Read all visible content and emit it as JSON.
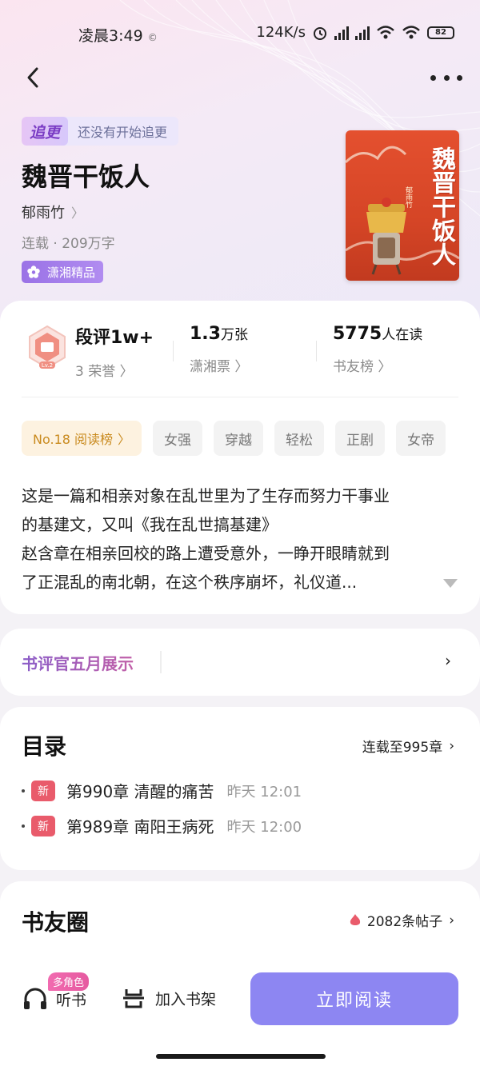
{
  "status_bar": {
    "time": "凌晨3:49",
    "net_speed": "124K/s",
    "battery": "82"
  },
  "book": {
    "follow_tag": "追更",
    "follow_text": "还没有开始追更",
    "title": "魏晋干饭人",
    "author": "郁雨竹",
    "status": "连载 · 209万字",
    "badge": "潇湘精品",
    "cover_title": "魏晋干饭人",
    "cover_author": "郁雨竹"
  },
  "stats": {
    "honor_level": "Lv.2",
    "review_value": "段评1w+",
    "review_sub": "3 荣誉",
    "ticket_value": "1.3",
    "ticket_unit": "万张",
    "ticket_sub": "潇湘票",
    "reader_value": "5775",
    "reader_unit": "人在读",
    "reader_sub": "书友榜"
  },
  "tags": {
    "rank": "No.18 阅读榜",
    "items": [
      "女强",
      "穿越",
      "轻松",
      "正剧",
      "女帝"
    ]
  },
  "description": [
    " 这是一篇和相亲对象在乱世里为了生存而努力干事业",
    "的基建文，又叫《我在乱世搞基建》",
    " 赵含章在相亲回校的路上遭受意外，一睁开眼睛就到",
    "了正混乱的南北朝，在这个秩序崩坏，礼仪道..."
  ],
  "banner": {
    "label": "书评官五月展示"
  },
  "toc": {
    "title": "目录",
    "progress": "连载至995章",
    "chapters": [
      {
        "badge": "新",
        "name": "第990章 清醒的痛苦",
        "time": "昨天 12:01"
      },
      {
        "badge": "新",
        "name": "第989章 南阳王病死",
        "time": "昨天 12:00"
      }
    ]
  },
  "community": {
    "title": "书友圈",
    "posts": "2082条帖子"
  },
  "bottom": {
    "multi_role": "多角色",
    "listen": "听书",
    "add_shelf": "加入书架",
    "read_now": "立即阅读"
  },
  "colors": {
    "accent": "#8d86f2",
    "new_badge": "#e95b6b",
    "rank_text": "#c98a1e",
    "cover": "#d54526"
  }
}
